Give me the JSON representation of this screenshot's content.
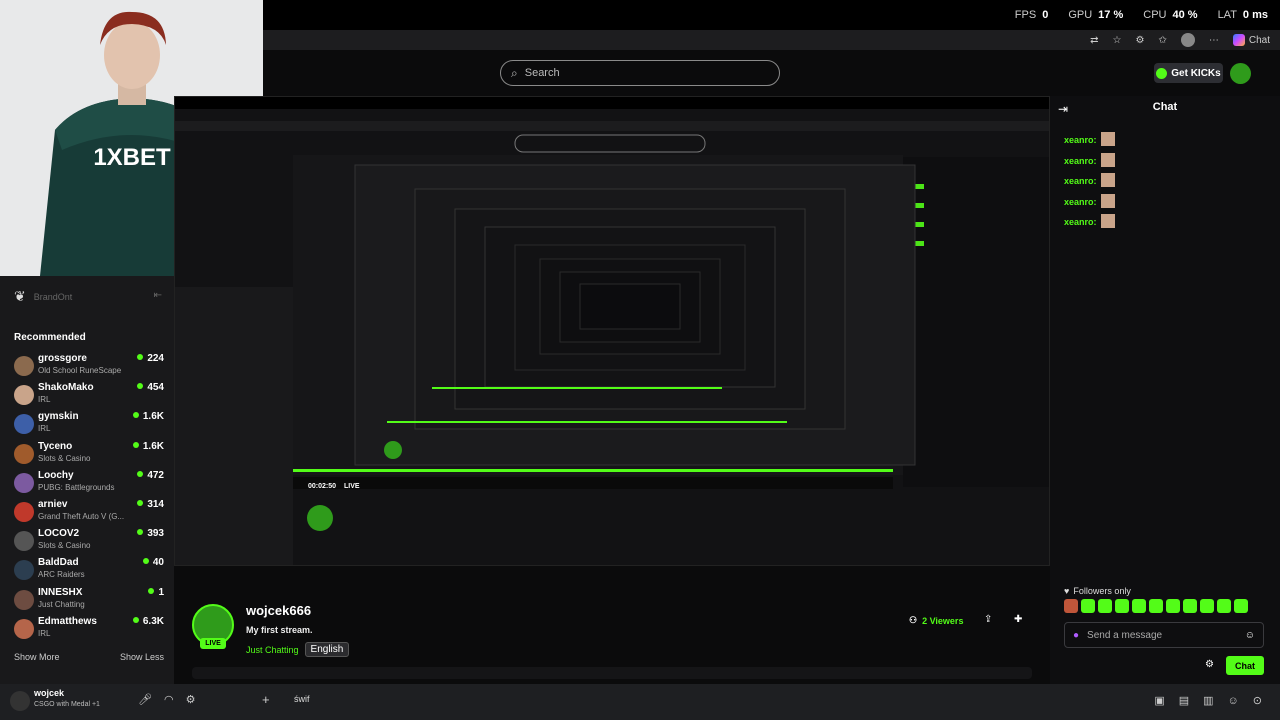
{
  "perf": {
    "fps_label": "FPS",
    "fps": "0",
    "gpu_label": "GPU",
    "gpu": "17 %",
    "cpu_label": "CPU",
    "cpu": "40 %",
    "lat_label": "LAT",
    "lat": "0 ms"
  },
  "browser": {
    "chat_btn": "Chat"
  },
  "header": {
    "search_placeholder": "Search",
    "get_kicks": "Get KICKs"
  },
  "sidebar": {
    "username": "BrandOnt",
    "recommended_title": "Recommended",
    "items": [
      {
        "name": "grossgore",
        "category": "Old School RuneScape",
        "viewers": "224",
        "color": "#8b6a4e"
      },
      {
        "name": "ShakoMako",
        "category": "IRL",
        "viewers": "454",
        "color": "#c9a48a"
      },
      {
        "name": "gymskin",
        "category": "IRL",
        "viewers": "1.6K",
        "color": "#3d5fa8"
      },
      {
        "name": "Tyceno",
        "category": "Slots & Casino",
        "viewers": "1.6K",
        "color": "#a05b2c"
      },
      {
        "name": "Loochy",
        "category": "PUBG: Battlegrounds",
        "viewers": "472",
        "color": "#7c5aa0"
      },
      {
        "name": "arniev",
        "category": "Grand Theft Auto V (G...",
        "viewers": "314",
        "color": "#c0392b"
      },
      {
        "name": "LOCOV2",
        "category": "Slots & Casino",
        "viewers": "393",
        "color": "#555"
      },
      {
        "name": "BaldDad",
        "category": "ARC Raiders",
        "viewers": "40",
        "color": "#2c3e50"
      },
      {
        "name": "INNESHX",
        "category": "Just Chatting",
        "viewers": "1",
        "color": "#6d4c41"
      },
      {
        "name": "Edmatthews",
        "category": "IRL",
        "viewers": "6.3K",
        "color": "#b5654a"
      }
    ],
    "show_more": "Show More",
    "show_less": "Show Less"
  },
  "preview": {
    "timer": "00:02:50",
    "live": "LIVE"
  },
  "stream": {
    "streamer": "wojcek666",
    "title": "My first stream.",
    "category": "Just Chatting",
    "tag": "English",
    "live_badge": "LIVE",
    "viewers": "2 Viewers"
  },
  "chat": {
    "title": "Chat",
    "messages": [
      {
        "user": "xeanro:"
      },
      {
        "user": "xeanro:"
      },
      {
        "user": "xeanro:"
      },
      {
        "user": "xeanro:"
      },
      {
        "user": "xeanro:"
      }
    ],
    "followers_only": "Followers only",
    "send_placeholder": "Send a message",
    "send_button": "Chat"
  },
  "taskbar": {
    "user": "wojcek",
    "status": "CSGO with Medal +1",
    "server": "świf"
  },
  "colors": {
    "accent": "#53fc18",
    "bg": "#0b0b0c"
  }
}
